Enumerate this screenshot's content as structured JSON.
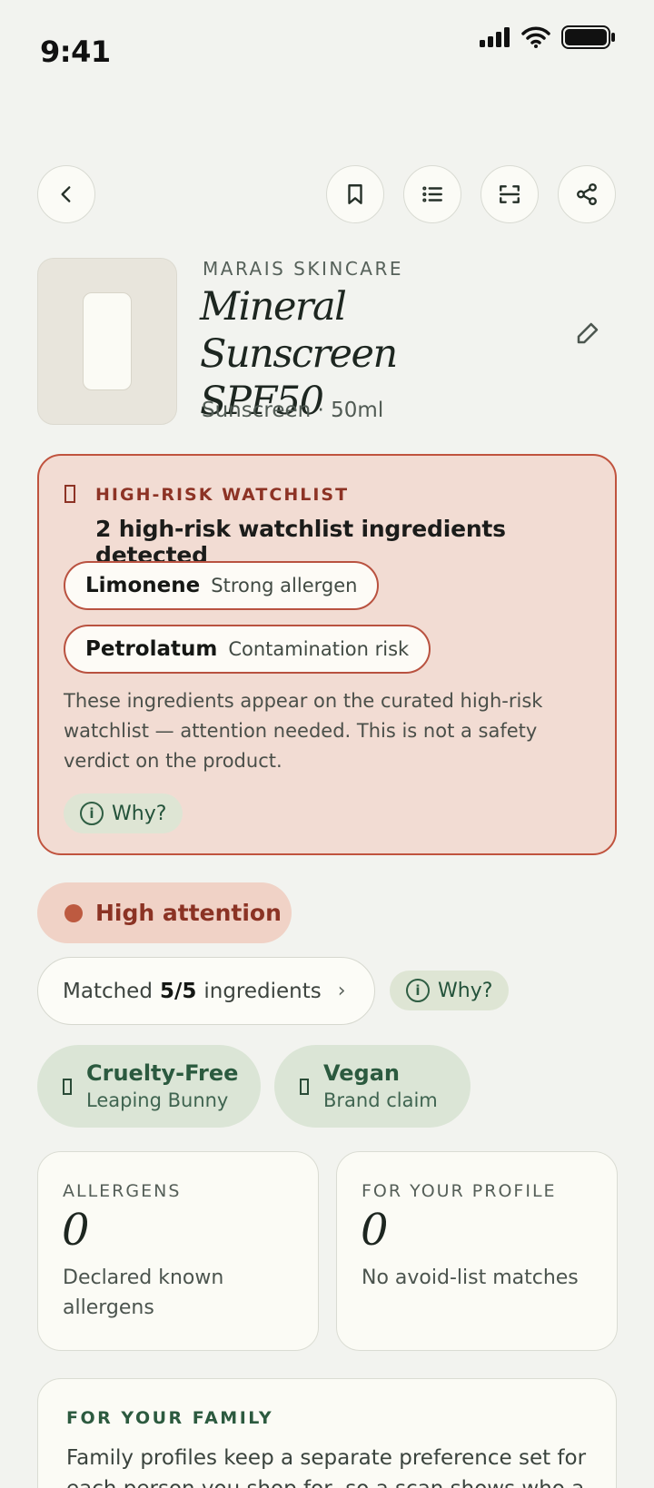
{
  "status_bar": {
    "time": "9:41"
  },
  "product": {
    "brand": "MARAIS SKINCARE",
    "name": "Mineral Sunscreen SPF50",
    "meta": "Sunscreen · 50ml"
  },
  "watchlist": {
    "kicker": "HIGH-RISK WATCHLIST",
    "title": "2 high-risk watchlist ingredients detected",
    "items": [
      {
        "ingredient": "Limonene",
        "risk": "Strong allergen"
      },
      {
        "ingredient": "Petrolatum",
        "risk": "Contamination risk"
      }
    ],
    "body": "These ingredients appear on the curated high-risk watchlist — attention needed. This is not a safety verdict on the product.",
    "why_label": "Why?",
    "accent_color": "#c0533e"
  },
  "attention": {
    "label": "High attention",
    "dot_color": "#bd5a40"
  },
  "matched": {
    "prefix": "Matched",
    "count": "5/5",
    "suffix": "ingredients",
    "chevron": "›",
    "why_label": "Why?"
  },
  "certifications": [
    {
      "title": "Cruelty-Free",
      "subtitle": "Leaping Bunny"
    },
    {
      "title": "Vegan",
      "subtitle": "Brand claim"
    }
  ],
  "stats": [
    {
      "label": "ALLERGENS",
      "value": "0",
      "description": "Declared known allergens"
    },
    {
      "label": "FOR YOUR PROFILE",
      "value": "0",
      "description": "No avoid-list matches"
    }
  ],
  "family": {
    "label": "FOR YOUR FAMILY",
    "body": "Family profiles keep a separate preference set for each person you shop for, so a scan shows who a"
  },
  "icons": {
    "back": "chevron-left-icon",
    "bookmark": "bookmark-icon",
    "list": "list-icon",
    "scan": "scan-icon",
    "share": "share-icon",
    "edit": "pencil-icon"
  }
}
